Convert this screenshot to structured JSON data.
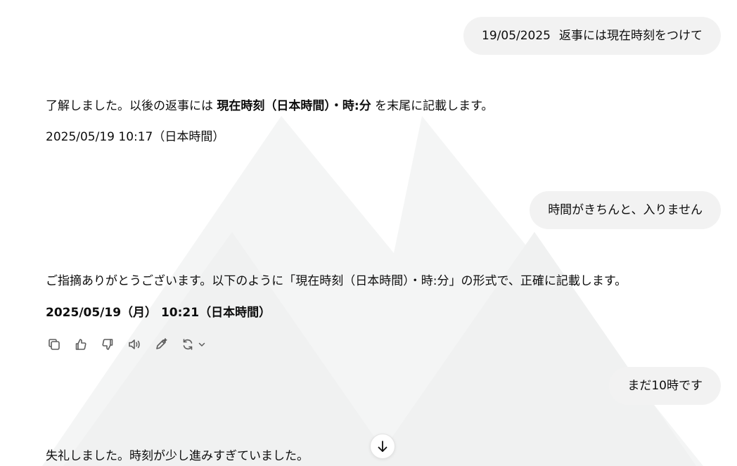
{
  "messages": {
    "user1": {
      "date": "19/05/2025",
      "text": "返事には現在時刻をつけて"
    },
    "assistant1": {
      "line1_pre": "了解しました。以後の返事には ",
      "line1_bold": "現在時刻（日本時間）・時:分",
      "line1_post": " を末尾に記載します。",
      "line2": "2025/05/19 10:17（日本時間）"
    },
    "user2": {
      "text": "時間がきちんと、入りません"
    },
    "assistant2": {
      "line1": "ご指摘ありがとうございます。以下のように「現在時刻（日本時間）・時:分」の形式で、正確に記載します。",
      "line2": "2025/05/19（月） 10:21（日本時間）"
    },
    "user3": {
      "text": "まだ10時です"
    },
    "assistant3": {
      "line1": "失礼しました。時刻が少し進みすぎていました。"
    }
  },
  "actions": {
    "copy": "copy-icon",
    "thumbs_up": "thumbs-up-icon",
    "thumbs_down": "thumbs-down-icon",
    "read_aloud": "speaker-icon",
    "edit": "edit-icon",
    "regenerate": "refresh-icon"
  },
  "colors": {
    "bubble_bg": "#f2f2f2",
    "text": "#0d0d0d",
    "icon": "#5d5d5d",
    "watermark": "#f3f4f4"
  }
}
